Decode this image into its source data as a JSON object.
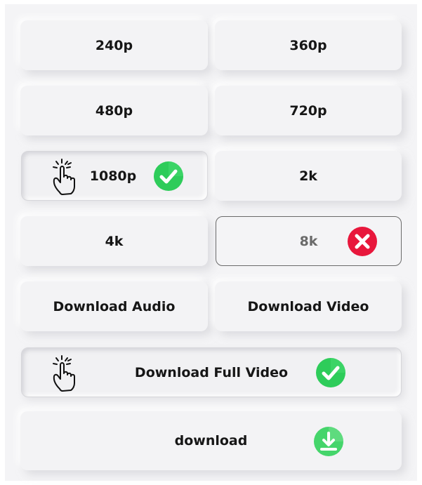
{
  "quality_options": [
    {
      "label": "240p"
    },
    {
      "label": "360p"
    },
    {
      "label": "480p"
    },
    {
      "label": "720p"
    },
    {
      "label": "1080p",
      "state": "selected",
      "badge": "check-icon"
    },
    {
      "label": "2k"
    },
    {
      "label": "4k"
    },
    {
      "label": "8k",
      "state": "unavailable",
      "badge": "x-icon"
    }
  ],
  "download_options": {
    "audio_label": "Download Audio",
    "video_label": "Download Video",
    "full_video_label": "Download Full Video",
    "full_video_state": "selected",
    "download_label": "download"
  },
  "icons": {
    "pointer": "hand-pointer-icon",
    "check": "check-icon",
    "error": "x-icon",
    "download": "download-icon"
  },
  "colors": {
    "check_green": "#2ecc5a",
    "error_red": "#e8173c",
    "download_green": "#45d56b"
  }
}
